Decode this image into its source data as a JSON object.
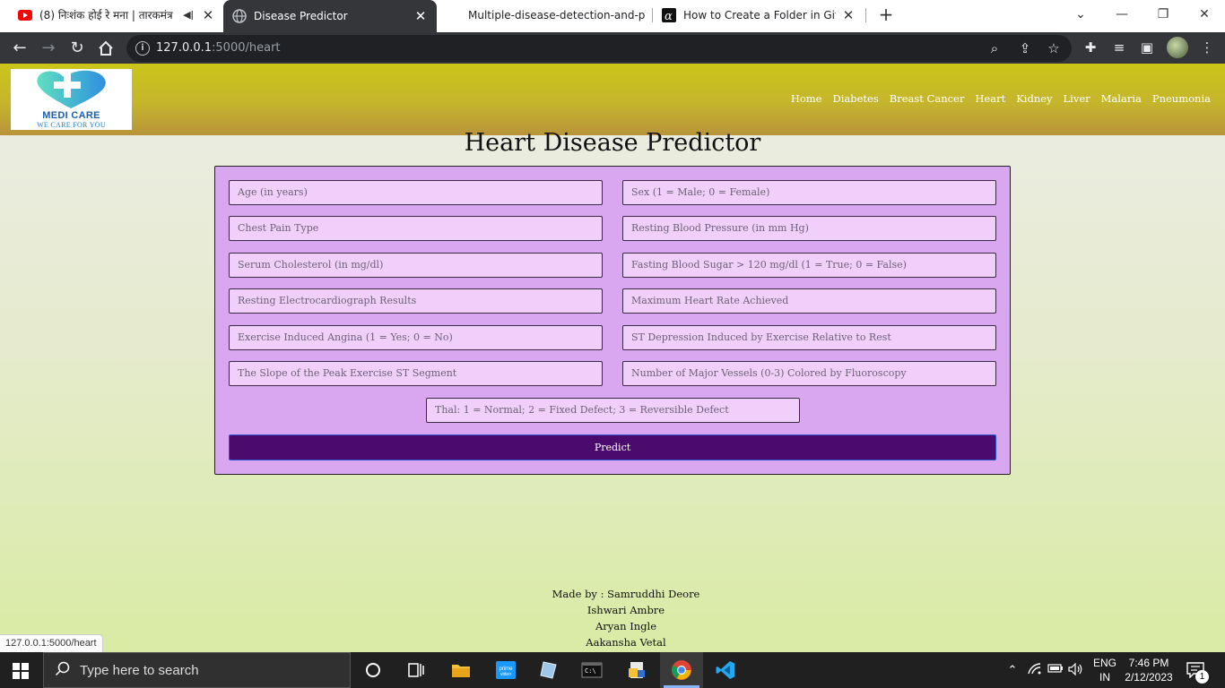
{
  "browser": {
    "tabs": [
      {
        "title": "(8) निःशंक होई रे मना | तारकमंत्र",
        "favicon": "youtube-icon",
        "audio": true,
        "active": false
      },
      {
        "title": "Disease Predictor",
        "favicon": "globe-icon",
        "active": true
      },
      {
        "title": "Multiple-disease-detection-and-p",
        "favicon": "github-icon",
        "active": false
      },
      {
        "title": "How to Create a Folder in Github",
        "favicon": "alpha-icon",
        "active": false
      }
    ],
    "url_host": "127.0.0.1",
    "url_path": ":5000/heart",
    "status_url": "127.0.0.1:5000/heart"
  },
  "site": {
    "logo_name": "MEDI CARE",
    "logo_tagline": "WE CARE FOR YOU",
    "nav": [
      "Home",
      "Diabetes",
      "Breast Cancer",
      "Heart",
      "Kidney",
      "Liver",
      "Malaria",
      "Pneumonia"
    ]
  },
  "form": {
    "title": "Heart Disease Predictor",
    "fields": [
      "Age (in years)",
      "Sex (1 = Male; 0 = Female)",
      "Chest Pain Type",
      "Resting Blood Pressure (in mm Hg)",
      "Serum Cholesterol (in mg/dl)",
      "Fasting Blood Sugar > 120 mg/dl (1 = True; 0 = False)",
      "Resting Electrocardiograph Results",
      "Maximum Heart Rate Achieved",
      "Exercise Induced Angina (1 = Yes; 0 = No)",
      "ST Depression Induced by Exercise Relative to Rest",
      "The Slope of the Peak Exercise ST Segment",
      "Number of Major Vessels (0-3) Colored by Fluoroscopy",
      "Thal: 1 = Normal; 2 = Fixed Defect; 3 = Reversible Defect"
    ],
    "submit_label": "Predict"
  },
  "footer": {
    "lines": [
      "Made by : Samruddhi Deore",
      "Ishwari Ambre",
      "Aryan Ingle",
      "Aakansha Vetal"
    ]
  },
  "taskbar": {
    "search_placeholder": "Type here to search",
    "lang_line1": "ENG",
    "lang_line2": "IN",
    "time": "7:46 PM",
    "date": "2/12/2023",
    "notification_count": "1"
  },
  "colors": {
    "header_top": "#cbc51a",
    "card_bg": "#d9a7f0",
    "field_bg": "#f0d0fb",
    "predict_bg": "#4b0b6e"
  }
}
